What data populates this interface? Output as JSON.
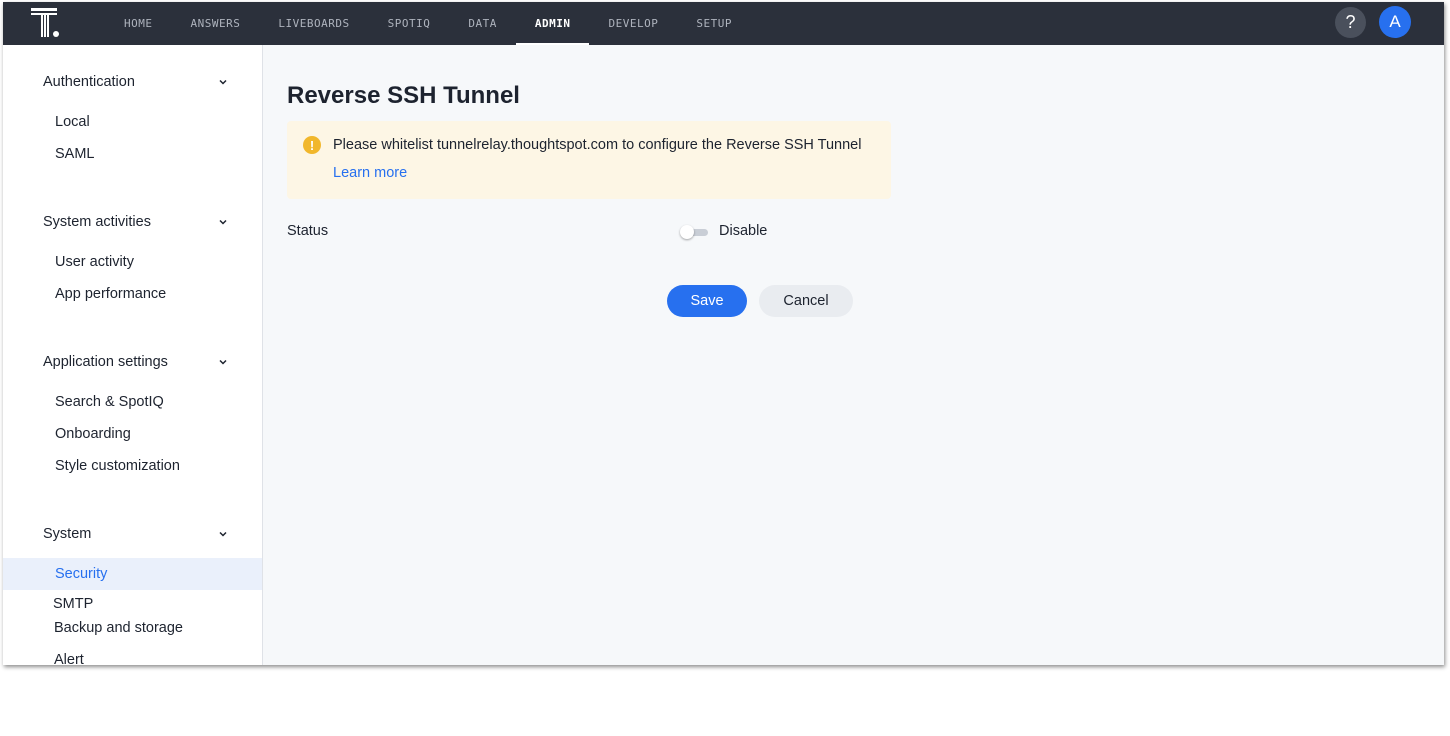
{
  "nav": {
    "items": [
      "HOME",
      "ANSWERS",
      "LIVEBOARDS",
      "SPOTIQ",
      "DATA",
      "ADMIN",
      "DEVELOP",
      "SETUP"
    ],
    "active": "ADMIN",
    "help_label": "?",
    "avatar_initial": "A"
  },
  "sidebar": {
    "sections": [
      {
        "title": "Authentication",
        "items": [
          "Local",
          "SAML"
        ]
      },
      {
        "title": "System activities",
        "items": [
          "User activity",
          "App performance"
        ]
      },
      {
        "title": "Application settings",
        "items": [
          "Search & SpotIQ",
          "Onboarding",
          "Style customization"
        ]
      },
      {
        "title": "System",
        "items": [
          "Security",
          "SMTP",
          "Backup and storage",
          "Alert"
        ]
      }
    ],
    "selected_item": "Security"
  },
  "main": {
    "title": "Reverse SSH Tunnel",
    "banner": {
      "icon": "warning-icon",
      "message": "Please whitelist tunnelrelay.thoughtspot.com to configure the Reverse SSH Tunnel",
      "link": "Learn more"
    },
    "status": {
      "label": "Status",
      "toggle_label": "Disable",
      "enabled": false
    },
    "buttons": {
      "save": "Save",
      "cancel": "Cancel"
    }
  },
  "colors": {
    "topbar": "#2b303b",
    "accent": "#2770ef",
    "banner_bg": "#fdf6e5",
    "warning": "#f1b72c"
  }
}
